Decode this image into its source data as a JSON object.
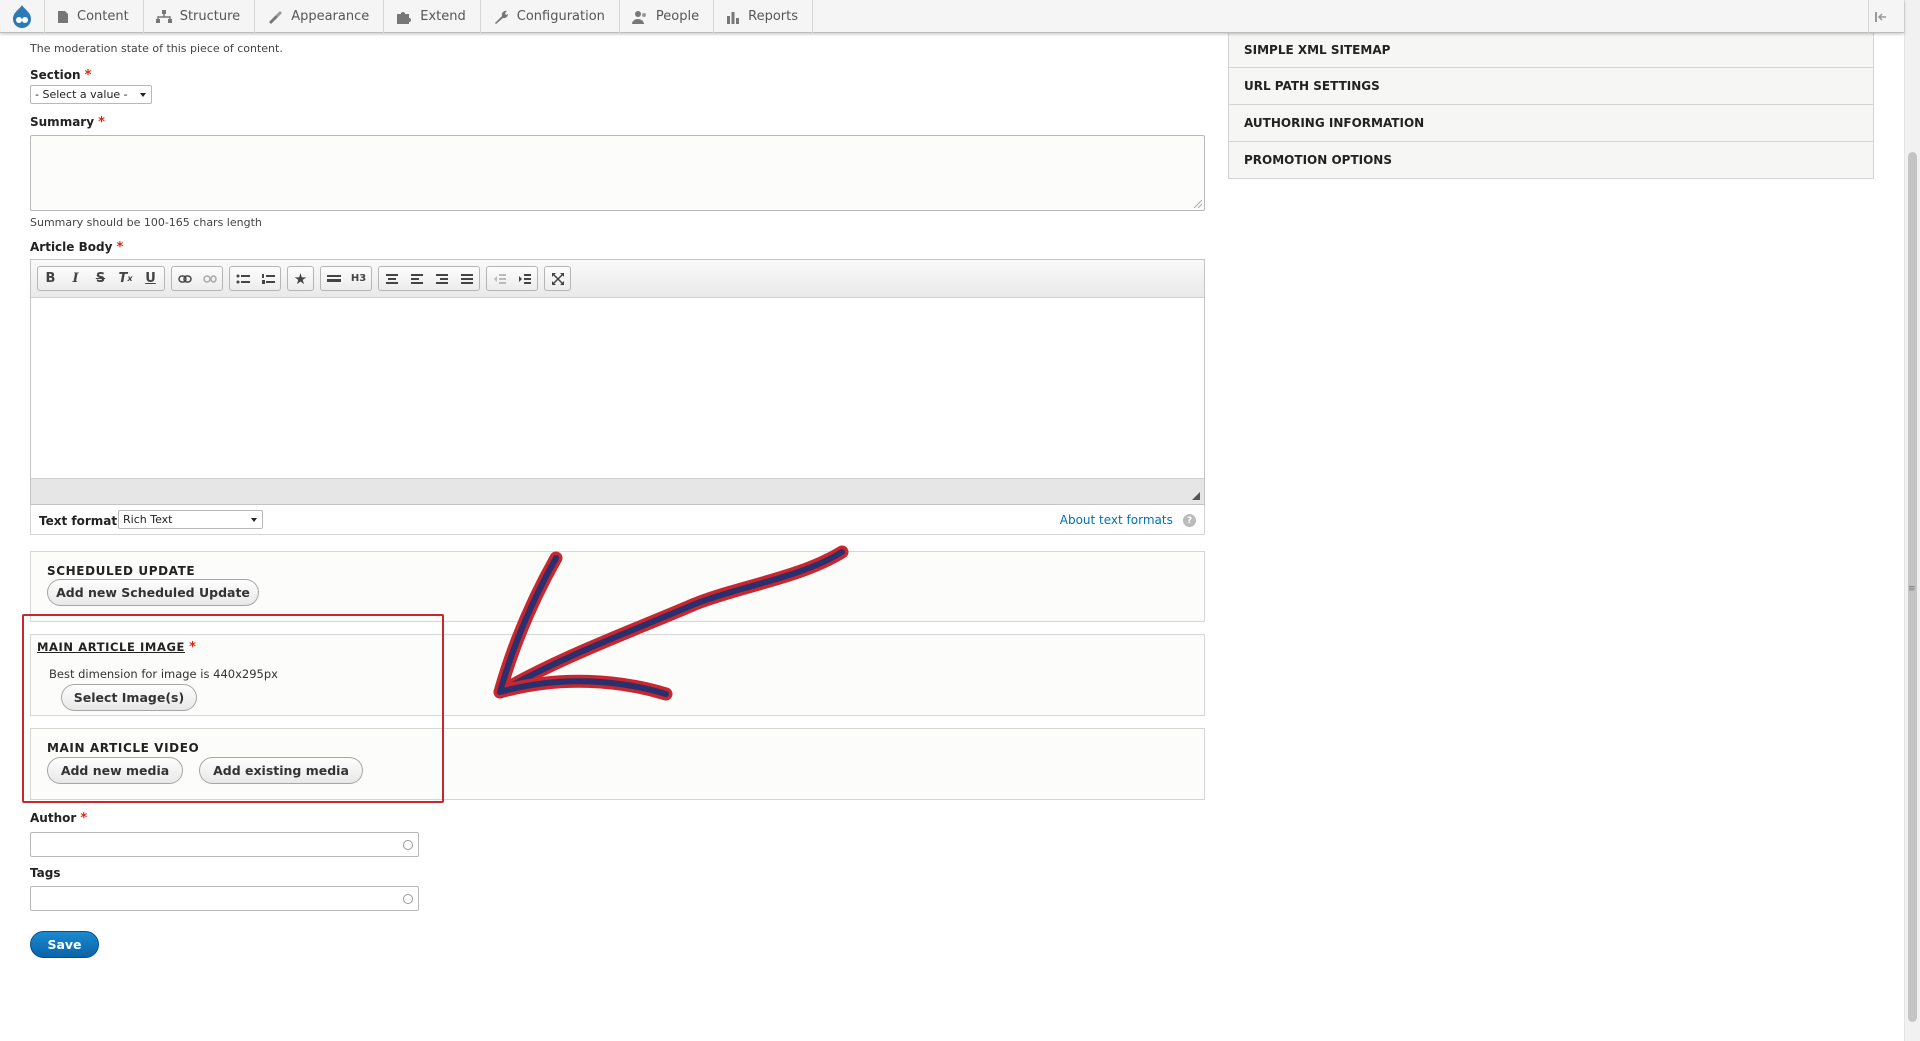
{
  "toolbar": {
    "items": [
      {
        "label": "Content",
        "icon": "document-icon"
      },
      {
        "label": "Structure",
        "icon": "structure-icon"
      },
      {
        "label": "Appearance",
        "icon": "paint-brush-icon"
      },
      {
        "label": "Extend",
        "icon": "puzzle-icon"
      },
      {
        "label": "Configuration",
        "icon": "wrench-icon"
      },
      {
        "label": "People",
        "icon": "people-icon"
      },
      {
        "label": "Reports",
        "icon": "bar-chart-icon"
      }
    ]
  },
  "form": {
    "moderation_desc": "The moderation state of this piece of content.",
    "section_label": "Section",
    "section_value": "- Select a value -",
    "summary_label": "Summary",
    "summary_desc": "Summary should be 100-165 chars length",
    "body_label": "Article Body",
    "text_format_label": "Text format",
    "text_format_value": "Rich Text",
    "about_formats": "About text formats",
    "help_glyph": "?",
    "scheduled_title": "SCHEDULED UPDATE",
    "scheduled_button": "Add new Scheduled Update",
    "image_title": "MAIN ARTICLE IMAGE",
    "image_desc": "Best dimension for image is 440x295px",
    "image_button": "Select Image(s)",
    "video_title": "MAIN ARTICLE VIDEO",
    "video_add_new": "Add new media",
    "video_add_existing": "Add existing media",
    "author_label": "Author",
    "tags_label": "Tags",
    "save_label": "Save",
    "required_mark": "*"
  },
  "sidebar": {
    "items": [
      {
        "label": "SIMPLE XML SITEMAP"
      },
      {
        "label": "URL PATH SETTINGS"
      },
      {
        "label": "AUTHORING INFORMATION"
      },
      {
        "label": "PROMOTION OPTIONS"
      }
    ]
  },
  "colors": {
    "accent": "#0071b3",
    "save_button": "#0a6eb4",
    "required": "#e2220c",
    "annotation": "#c9262d"
  }
}
